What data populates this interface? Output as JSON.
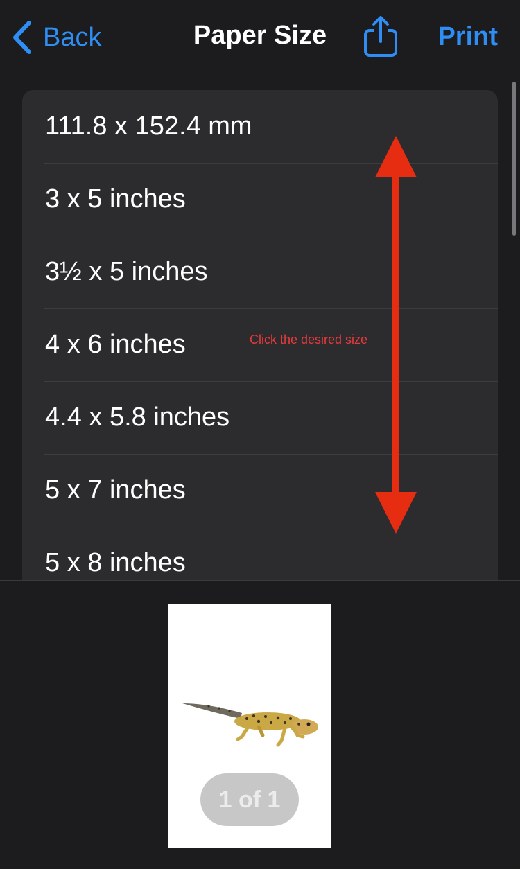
{
  "nav": {
    "back_label": "Back",
    "title": "Paper Size",
    "share_icon": "share-icon",
    "print_label": "Print"
  },
  "paper_sizes": [
    "111.8 x 152.4 mm",
    "3 x 5 inches",
    "3½ x 5 inches",
    "4 x 6 inches",
    "4.4 x 5.8 inches",
    "5 x 7 inches",
    "5 x 8 inches"
  ],
  "annotation": {
    "text": "Click the desired size",
    "color": "#e8393c"
  },
  "preview": {
    "page_indicator": "1 of 1",
    "image": "gecko-photo"
  },
  "colors": {
    "accent": "#2f8ef4",
    "background": "#1c1c1e",
    "card": "#2c2c2e"
  }
}
